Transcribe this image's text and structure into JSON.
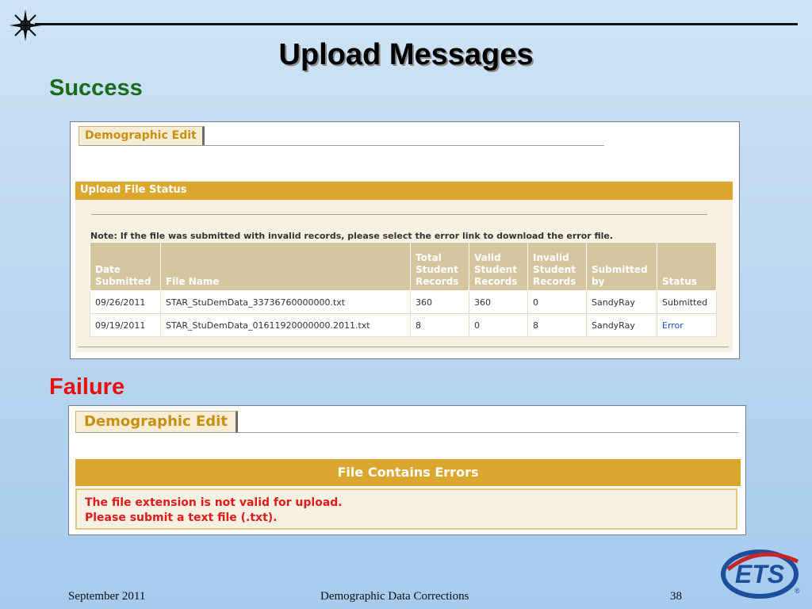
{
  "slide": {
    "title": "Upload Messages",
    "success_label": "Success",
    "failure_label": "Failure"
  },
  "success_panel": {
    "tab_label": "Demographic Edit",
    "status_title": "Upload File Status",
    "note": "Note: If the file was submitted with invalid records, please select the error link to download the error file.",
    "table": {
      "headers": [
        [
          "Date",
          "Submitted"
        ],
        [
          "File Name"
        ],
        [
          "Total",
          "Student",
          "Records"
        ],
        [
          "Valid",
          "Student",
          "Records"
        ],
        [
          "Invalid",
          "Student",
          "Records"
        ],
        [
          "Submitted",
          "by"
        ],
        [
          "Status"
        ]
      ],
      "rows": [
        [
          "09/26/2011",
          "STAR_StuDemData_33736760000000.txt",
          "360",
          "360",
          "0",
          "SandyRay",
          "Submitted"
        ],
        [
          "09/19/2011",
          "STAR_StuDemData_01611920000000.2011.txt",
          "8",
          "0",
          "8",
          "SandyRay",
          "Error"
        ]
      ]
    }
  },
  "failure_panel": {
    "tab_label": "Demographic Edit",
    "header": "File Contains Errors",
    "messages": [
      "The file extension is not valid for upload.",
      "Please submit a text file (.txt)."
    ]
  },
  "footer": {
    "date": "September 2011",
    "center": "Demographic Data Corrections",
    "page_number": "38"
  },
  "logo": {
    "text": "ETS",
    "registered": "®"
  },
  "colors": {
    "gold": "#dba72e",
    "success_green": "#1a6b1a",
    "failure_red": "#e8120c",
    "error_link": "#1a56c7",
    "logo_blue": "#1c4e9c",
    "logo_swoosh": "#c8242c"
  }
}
